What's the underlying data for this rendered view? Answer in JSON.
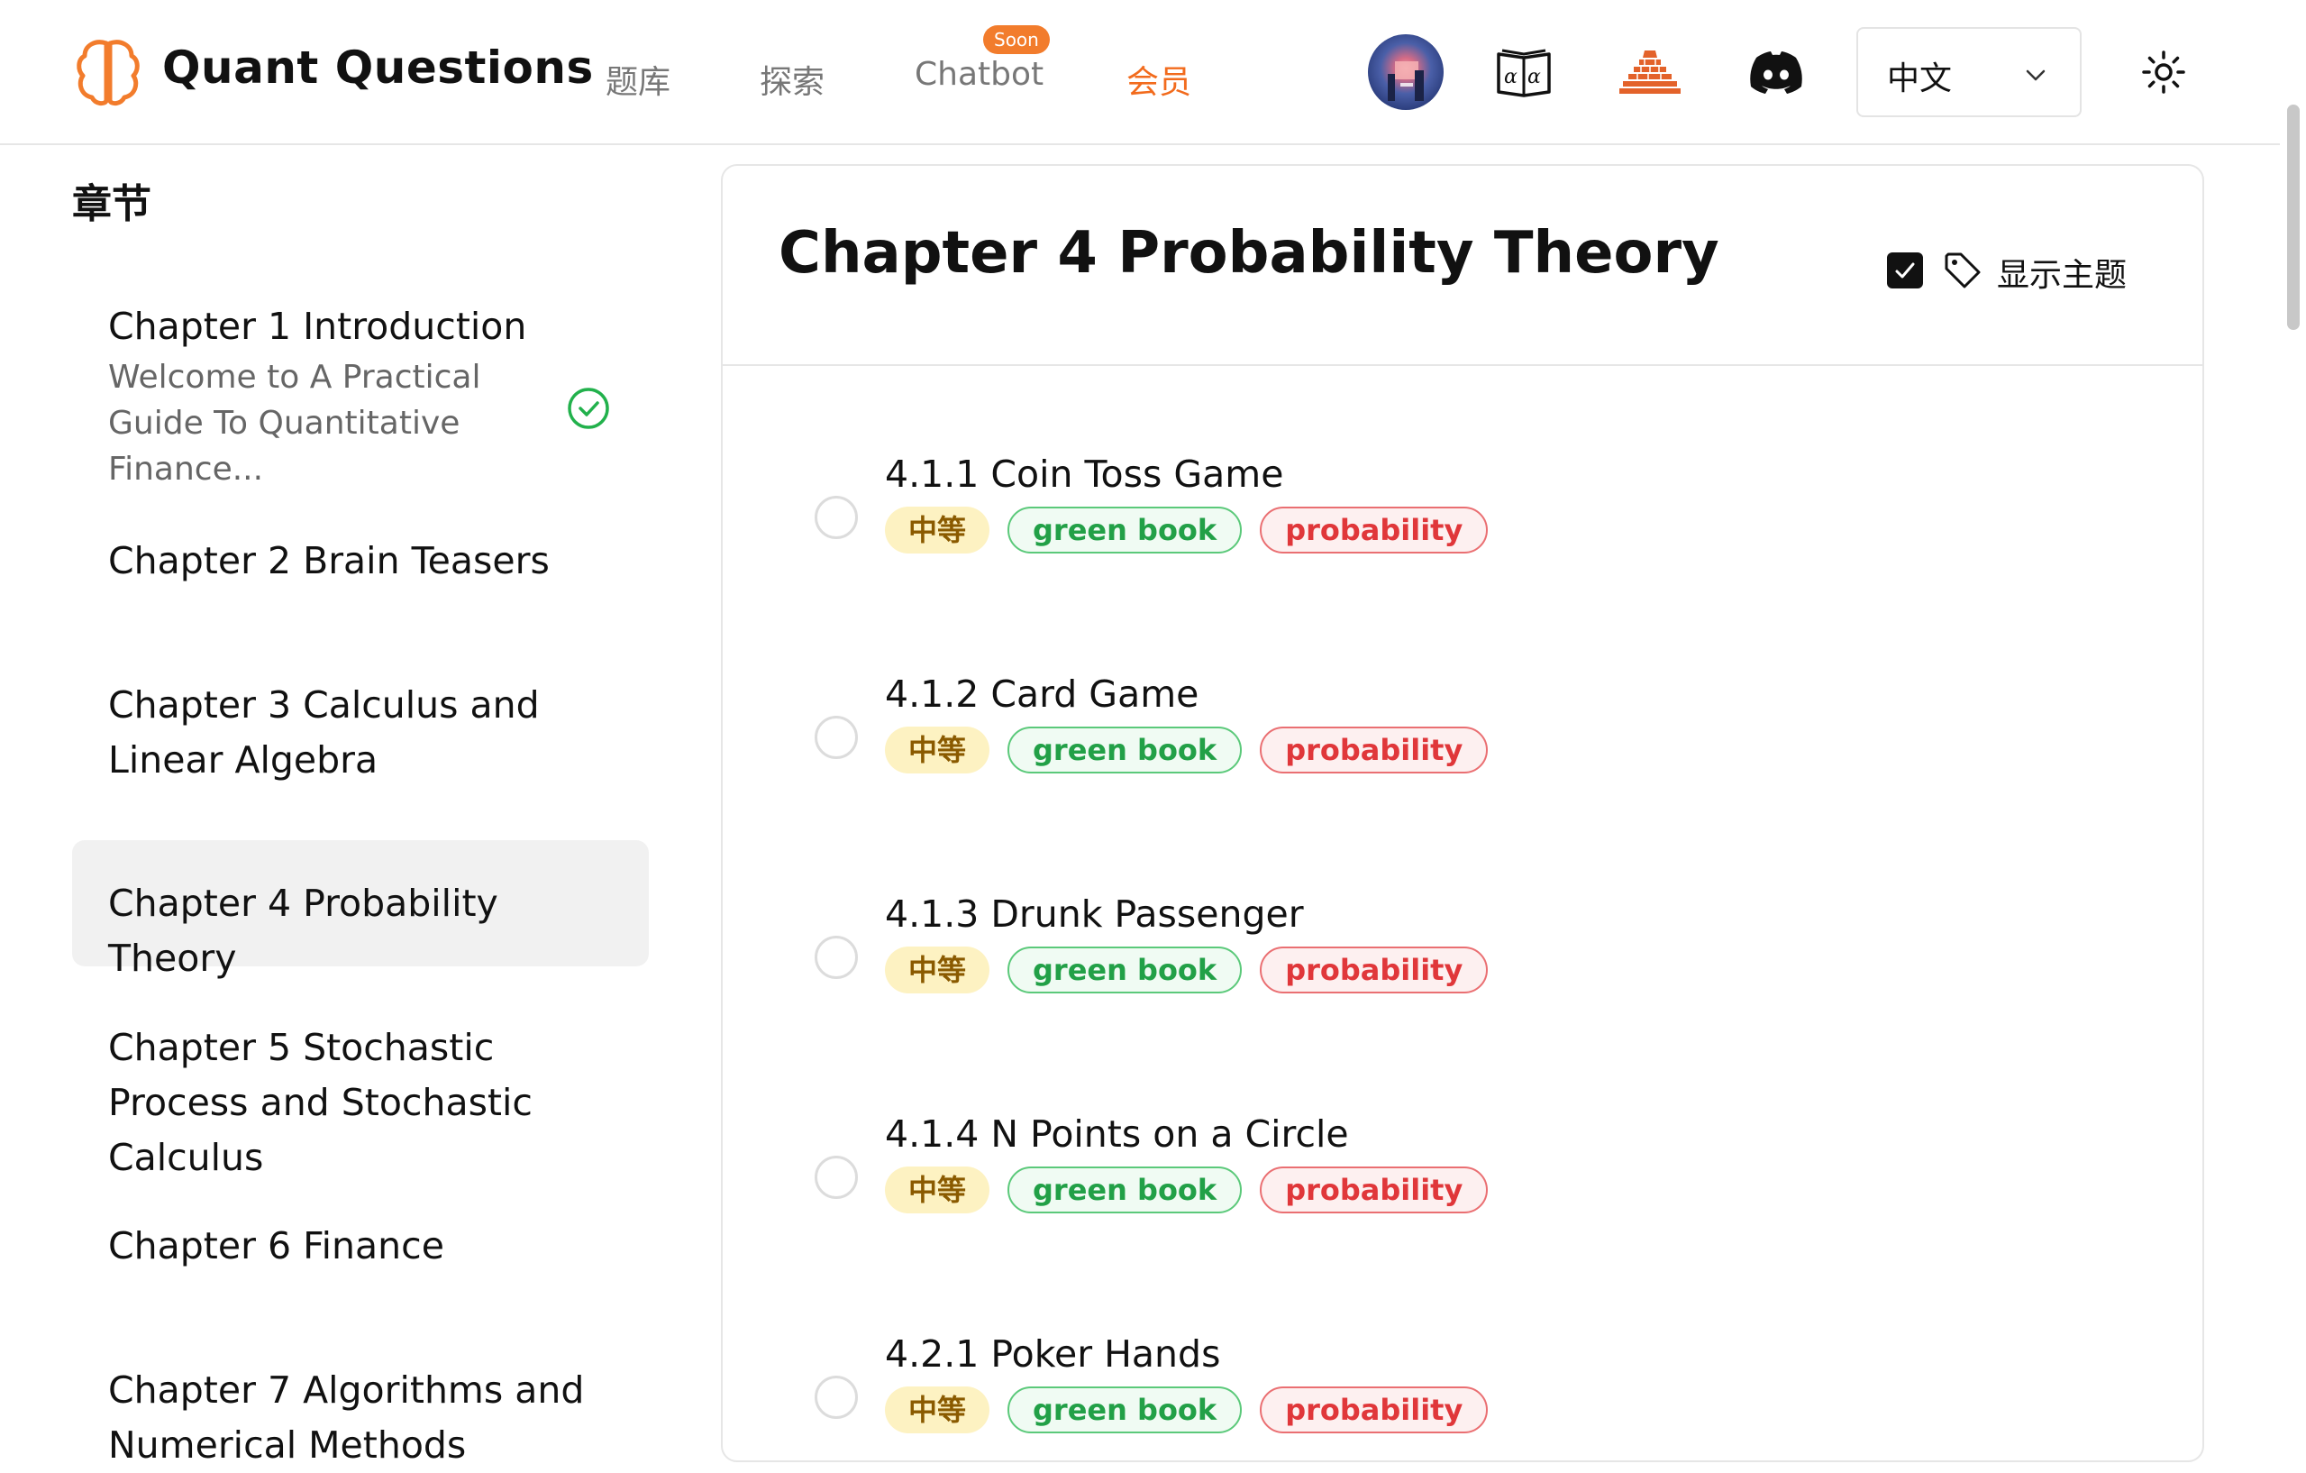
{
  "header": {
    "brand": "Quant Questions",
    "nav": [
      {
        "label": "题库"
      },
      {
        "label": "探索"
      },
      {
        "label": "Chatbot",
        "badge": "Soon"
      },
      {
        "label": "会员"
      }
    ],
    "icons": [
      "avatar",
      "book-alpha-icon",
      "great-wall-icon",
      "discord-icon"
    ],
    "language": "中文",
    "theme_icon": "sun-icon"
  },
  "sidebar": {
    "title": "章节",
    "chapters": [
      {
        "label": "Chapter 1 Introduction",
        "subtitle": "Welcome to A Practical Guide To Quantitative Finance...",
        "completed": true
      },
      {
        "label": "Chapter 2 Brain Teasers"
      },
      {
        "label": "Chapter 3 Calculus and Linear Algebra"
      },
      {
        "label": "Chapter 4 Probability Theory",
        "selected": true
      },
      {
        "label": "Chapter 5 Stochastic Process and Stochastic Calculus"
      },
      {
        "label": "Chapter 6 Finance"
      },
      {
        "label": "Chapter 7 Algorithms and Numerical Methods"
      }
    ]
  },
  "main": {
    "title": "Chapter 4 Probability Theory",
    "show_topic": {
      "label": "显示主题",
      "checked": true
    },
    "questions": [
      {
        "title": "4.1.1 Coin Toss Game",
        "difficulty": "中等",
        "book": "green book",
        "topic": "probability"
      },
      {
        "title": "4.1.2 Card Game",
        "difficulty": "中等",
        "book": "green book",
        "topic": "probability"
      },
      {
        "title": "4.1.3 Drunk Passenger",
        "difficulty": "中等",
        "book": "green book",
        "topic": "probability"
      },
      {
        "title": "4.1.4 N Points on a Circle",
        "difficulty": "中等",
        "book": "green book",
        "topic": "probability"
      },
      {
        "title": "4.2.1 Poker Hands",
        "difficulty": "中等",
        "book": "green book",
        "topic": "probability"
      }
    ]
  },
  "colors": {
    "accent": "#f26b1d",
    "difficulty_bg": "#fdf2c2",
    "book_green": "#22a047",
    "topic_red": "#e0373a"
  }
}
